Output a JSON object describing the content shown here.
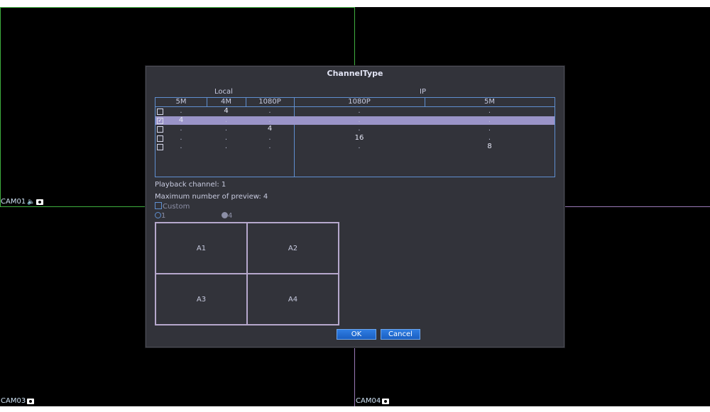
{
  "cameras": {
    "cam01": "CAM01",
    "cam03": "CAM03",
    "cam04": "CAM04",
    "colors": {
      "green": "#3fae3f",
      "purple": "#9a7ab8"
    }
  },
  "dialog": {
    "title": "ChannelType",
    "group_local": "Local",
    "group_ip": "IP",
    "columns": [
      "5M",
      "4M",
      "1080P",
      "1080P",
      "5M"
    ],
    "rows": [
      {
        "checked": false,
        "values": [
          ".",
          "4",
          ".",
          ".",
          "."
        ]
      },
      {
        "checked": true,
        "values": [
          "4",
          ".",
          ".",
          ".",
          "."
        ]
      },
      {
        "checked": false,
        "values": [
          ".",
          ".",
          "4",
          ".",
          "."
        ]
      },
      {
        "checked": false,
        "values": [
          ".",
          ".",
          ".",
          "16",
          "."
        ]
      },
      {
        "checked": false,
        "values": [
          ".",
          ".",
          ".",
          ".",
          "8"
        ]
      }
    ],
    "playback_channel": "Playback channel: 1",
    "max_preview": "Maximum number of preview: 4",
    "custom_label": "Custom",
    "radio_1_label": "1",
    "radio_4_label": "4",
    "preview_cells": [
      "A1",
      "A2",
      "A3",
      "A4"
    ],
    "ok_label": "OK",
    "cancel_label": "Cancel",
    "selected_row_color": "#9a94c8",
    "accent": "#1a5fc2"
  }
}
